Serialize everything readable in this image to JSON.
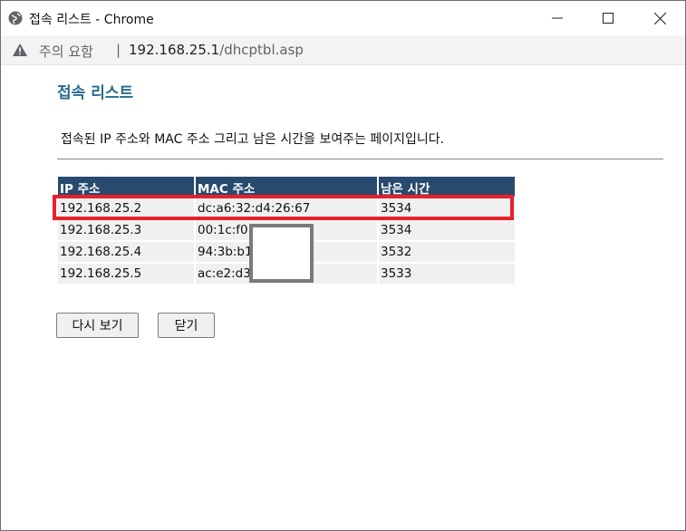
{
  "window": {
    "title": "접속 리스트 - Chrome"
  },
  "address_bar": {
    "warning": "주의 요함",
    "separator": "|",
    "host": "192.168.25.1",
    "path": "/dhcptbl.asp"
  },
  "page": {
    "title": "접속 리스트",
    "description": "접속된 IP 주소와 MAC 주소 그리고 남은 시간을 보여주는 페이지입니다."
  },
  "table": {
    "headers": [
      "IP 주소",
      "MAC 주소",
      "남은 시간"
    ],
    "rows": [
      [
        "192.168.25.2",
        "dc:a6:32:d4:26:67",
        "3534"
      ],
      [
        "192.168.25.3",
        "00:1c:f0",
        "3534"
      ],
      [
        "192.168.25.4",
        "94:3b:b1",
        "3532"
      ],
      [
        "192.168.25.5",
        "ac:e2:d3",
        "3533"
      ]
    ]
  },
  "buttons": {
    "refresh": "다시 보기",
    "close": "닫기"
  },
  "colors": {
    "header_bg": "#284a6e",
    "title": "#2a6b8c",
    "highlight": "#e8202b"
  }
}
